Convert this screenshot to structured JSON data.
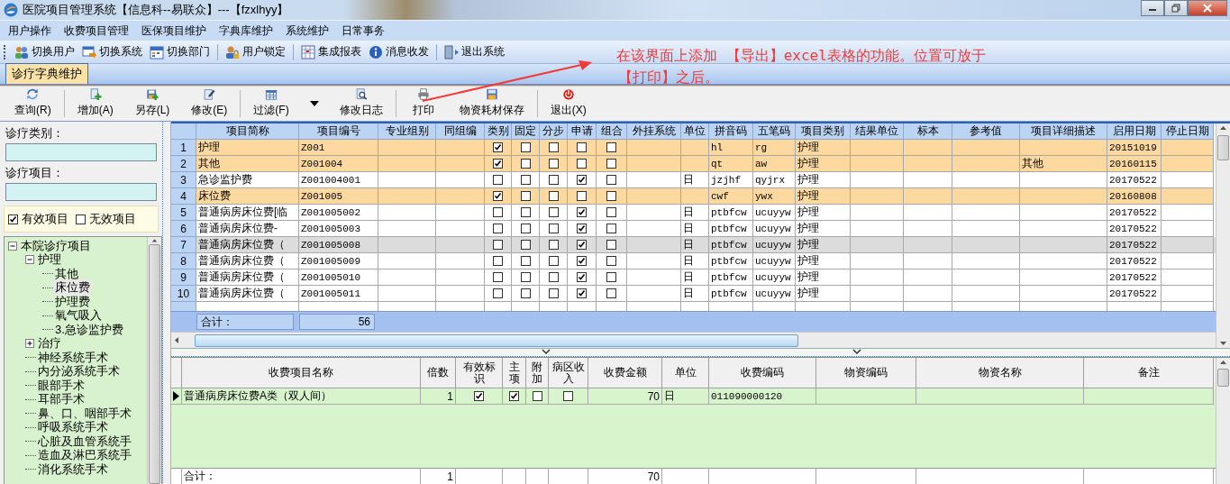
{
  "window": {
    "title": "医院项目管理系统【信息科--易联众】---【fzxlhyy】"
  },
  "menu": [
    "用户操作",
    "收费项目管理",
    "医保项目维护",
    "字典库维护",
    "系统维护",
    "日常事务"
  ],
  "toolbar": [
    {
      "kind": "button",
      "label": "切换用户"
    },
    {
      "kind": "button",
      "label": "切换系统"
    },
    {
      "kind": "button",
      "label": "切换部门"
    },
    {
      "kind": "separator"
    },
    {
      "kind": "button",
      "label": "用户锁定"
    },
    {
      "kind": "separator"
    },
    {
      "kind": "button",
      "label": "集成报表"
    },
    {
      "kind": "button",
      "label": "消息收发"
    },
    {
      "kind": "separator"
    },
    {
      "kind": "button",
      "label": "退出系统"
    }
  ],
  "tabs": [
    {
      "label": "诊疗字典维护",
      "selected": true
    }
  ],
  "actions": [
    {
      "kind": "button",
      "label": "查询(R)"
    },
    {
      "kind": "separator"
    },
    {
      "kind": "button",
      "label": "增加(A)"
    },
    {
      "kind": "button",
      "label": "另存(L)"
    },
    {
      "kind": "button",
      "label": "修改(E)"
    },
    {
      "kind": "separator"
    },
    {
      "kind": "dropdown",
      "label": "过滤(F)"
    },
    {
      "kind": "button",
      "label": "修改日志"
    },
    {
      "kind": "separator"
    },
    {
      "kind": "button",
      "label": "打印"
    },
    {
      "kind": "button",
      "label": "物资耗材保存"
    },
    {
      "kind": "separator"
    },
    {
      "kind": "button",
      "label": "退出(X)"
    }
  ],
  "annotation": {
    "lines": [
      "在该界面上添加 【导出】excel表格的功能。位置可放于",
      "【打印】之后。"
    ]
  },
  "filter": {
    "category_label": "诊疗类别：",
    "item_label": "诊疗项目：",
    "options": [
      {
        "label": "有效项目",
        "checked": true
      },
      {
        "label": "无效项目",
        "checked": false
      }
    ]
  },
  "tree": [
    {
      "label": "本院诊疗项目",
      "expanded": true,
      "selected": false,
      "children": [
        {
          "label": "护理",
          "expanded": true,
          "selected": false,
          "children": [
            {
              "label": "其他",
              "selected": false
            },
            {
              "label": "床位费",
              "selected": true
            },
            {
              "label": "护理费",
              "selected": false
            },
            {
              "label": "氧气吸入",
              "selected": false
            },
            {
              "label": "3.急诊监护费",
              "selected": false
            }
          ]
        },
        {
          "label": "治疗",
          "expanded": false,
          "selected": false
        },
        {
          "label": "神经系统手术",
          "selected": false
        },
        {
          "label": "内分泌系统手术",
          "selected": false
        },
        {
          "label": "眼部手术",
          "selected": false
        },
        {
          "label": "耳部手术",
          "selected": false
        },
        {
          "label": "鼻、口、咽部手术",
          "selected": false
        },
        {
          "label": "呼吸系统手术",
          "selected": false
        },
        {
          "label": "心脏及血管系统手",
          "selected": false
        },
        {
          "label": "造血及淋巴系统手",
          "selected": false
        },
        {
          "label": "消化系统手术",
          "selected": false
        }
      ]
    }
  ],
  "items_table": {
    "columns": [
      "项目简称",
      "项目编号",
      "专业组别",
      "同组编",
      "类别",
      "固定",
      "分步",
      "申请",
      "组合",
      "外挂系统",
      "单位",
      "拼音码",
      "五笔码",
      "项目类别",
      "结果单位",
      "标本",
      "参考值",
      "项目详细描述",
      "启用日期",
      "停止日期"
    ],
    "rows": [
      {
        "no": "1",
        "kind": "category",
        "selected": false,
        "name": "护理",
        "code": "Z001",
        "type_flag": true,
        "fixed": false,
        "step": false,
        "apply": false,
        "group": false,
        "pinyin": "hl",
        "wubi": "rg",
        "category": "护理",
        "start_date": "20151019"
      },
      {
        "no": "2",
        "kind": "category",
        "selected": false,
        "name": "其他",
        "code": "Z001004",
        "type_flag": true,
        "fixed": false,
        "step": false,
        "apply": false,
        "group": false,
        "pinyin": "qt",
        "wubi": "aw",
        "category": "护理",
        "description": "其他",
        "start_date": "20160115"
      },
      {
        "no": "3",
        "kind": "item",
        "selected": false,
        "name": "急诊监护费",
        "code": "Z001004001",
        "type_flag": false,
        "fixed": false,
        "step": false,
        "apply": true,
        "group": false,
        "unit": "日",
        "pinyin": "jzjhf",
        "wubi": "qyjrx",
        "category": "护理",
        "start_date": "20170522"
      },
      {
        "no": "4",
        "kind": "category",
        "selected": false,
        "name": "床位费",
        "code": "Z001005",
        "type_flag": true,
        "fixed": false,
        "step": false,
        "apply": false,
        "group": false,
        "pinyin": "cwf",
        "wubi": "ywx",
        "category": "护理",
        "start_date": "20160808"
      },
      {
        "no": "5",
        "kind": "item",
        "selected": false,
        "name": "普通病房床位费[临",
        "code": "Z001005002",
        "type_flag": false,
        "fixed": false,
        "step": false,
        "apply": true,
        "group": false,
        "unit": "日",
        "pinyin": "ptbfcw",
        "wubi": "ucuyyw",
        "category": "护理",
        "start_date": "20170522"
      },
      {
        "no": "6",
        "kind": "item",
        "selected": false,
        "name": "普通病房床位费-",
        "code": "Z001005003",
        "type_flag": false,
        "fixed": false,
        "step": false,
        "apply": true,
        "group": false,
        "unit": "日",
        "pinyin": "ptbfcw",
        "wubi": "ucuyyw",
        "category": "护理",
        "start_date": "20170522"
      },
      {
        "no": "7",
        "kind": "item",
        "selected": true,
        "name": "普通病房床位费（",
        "code": "Z001005008",
        "type_flag": false,
        "fixed": false,
        "step": false,
        "apply": true,
        "group": false,
        "unit": "日",
        "pinyin": "ptbfcw",
        "wubi": "ucuyyw",
        "category": "护理",
        "start_date": "20170522"
      },
      {
        "no": "8",
        "kind": "item",
        "selected": false,
        "name": "普通病房床位费（",
        "code": "Z001005009",
        "type_flag": false,
        "fixed": false,
        "step": false,
        "apply": true,
        "group": false,
        "unit": "日",
        "pinyin": "ptbfcw",
        "wubi": "ucuyyw",
        "category": "护理",
        "start_date": "20170522"
      },
      {
        "no": "9",
        "kind": "item",
        "selected": false,
        "name": "普通病房床位费（",
        "code": "Z001005010",
        "type_flag": false,
        "fixed": false,
        "step": false,
        "apply": true,
        "group": false,
        "unit": "日",
        "pinyin": "ptbfcw",
        "wubi": "ucuyyw",
        "category": "护理",
        "start_date": "20170522"
      },
      {
        "no": "10",
        "kind": "item",
        "selected": false,
        "name": "普通病房床位费（",
        "code": "Z001005011",
        "type_flag": false,
        "fixed": false,
        "step": false,
        "apply": true,
        "group": false,
        "unit": "日",
        "pinyin": "ptbfcw",
        "wubi": "ucuyyw",
        "category": "护理",
        "start_date": "20170522"
      }
    ],
    "total_label": "合计：",
    "total": "56"
  },
  "fees_table": {
    "columns": [
      "收费项目名称",
      "倍数",
      "有效标识",
      "主项",
      "附加",
      "病区收入",
      "收费金额",
      "单位",
      "收费编码",
      "物资编码",
      "物资名称",
      "备注"
    ],
    "rows": [
      {
        "selected": true,
        "name": "普通病房床位费A类（双人间）",
        "multiplier": "1",
        "valid": true,
        "main": true,
        "extra": false,
        "ward_income": false,
        "amount": "70",
        "unit": "日",
        "code": "011090000120"
      }
    ],
    "total_label": "合计：",
    "total_multiplier": "1",
    "total_amount": "70"
  }
}
